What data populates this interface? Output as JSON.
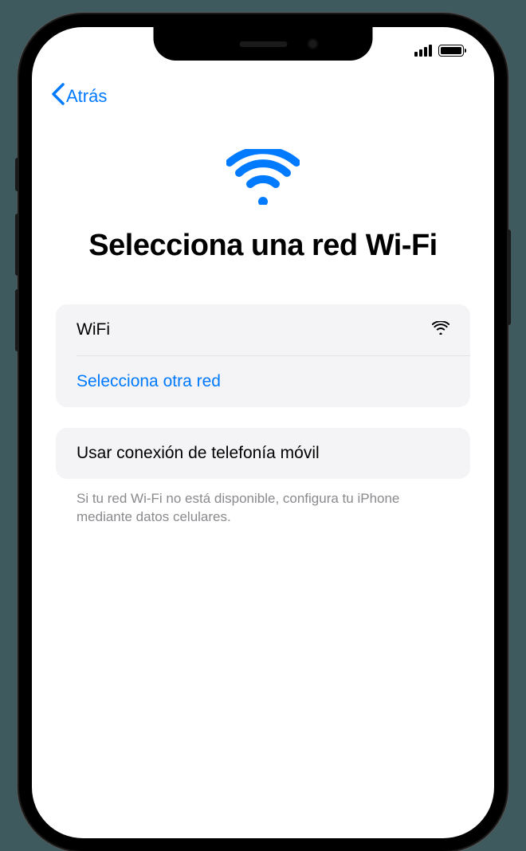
{
  "nav": {
    "back_label": "Atrás"
  },
  "page": {
    "title": "Selecciona una red Wi‑Fi"
  },
  "networks": {
    "primary": {
      "name": "WiFi"
    },
    "other_label": "Selecciona otra red"
  },
  "cellular": {
    "button_label": "Usar conexión de telefonía móvil",
    "footer_note": "Si tu red Wi‑Fi no está disponible, configura tu iPhone mediante datos celulares."
  },
  "colors": {
    "accent": "#007aff"
  }
}
